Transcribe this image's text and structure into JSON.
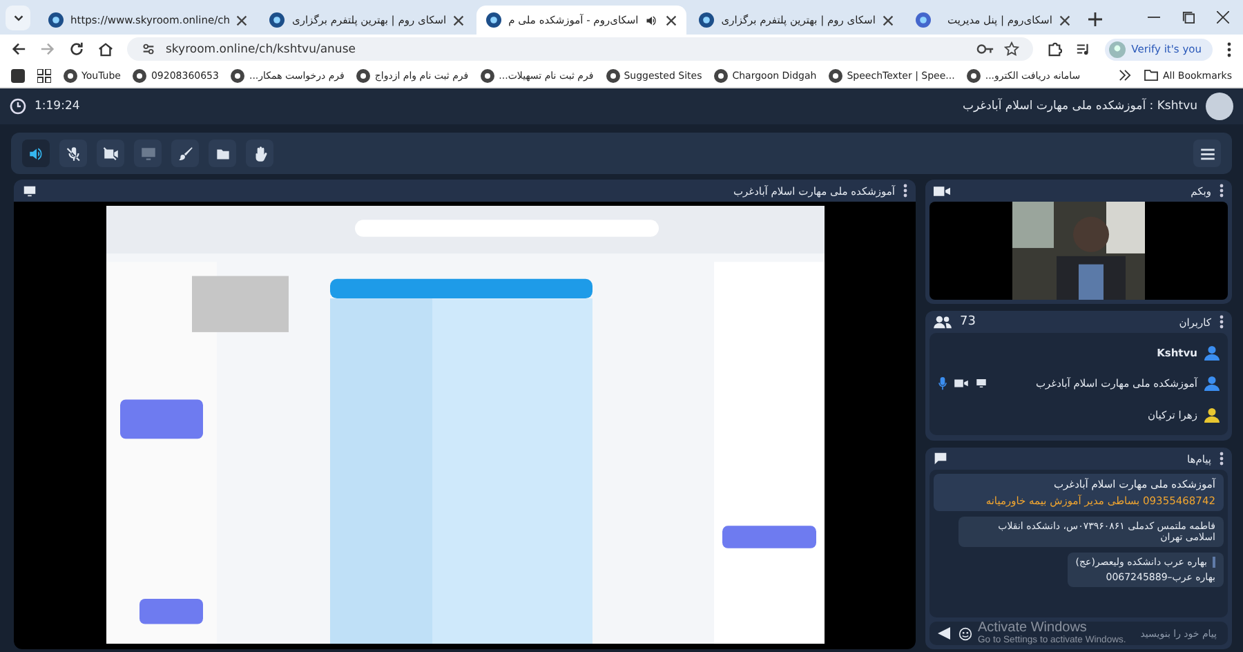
{
  "browser": {
    "tabs": [
      {
        "title": "اسکای‌روم | پنل مدیریت",
        "selected": false,
        "audio": false
      },
      {
        "title": "اسکای روم | بهترین پلتفرم برگزاری",
        "selected": false,
        "audio": false
      },
      {
        "title": "اسکای‌روم - آموزشکده ملی م",
        "selected": true,
        "audio": true
      },
      {
        "title": "اسکای روم | بهترین پلتفرم برگزاری",
        "selected": false,
        "audio": false
      },
      {
        "title": "https://www.skyroom.online/ch",
        "selected": false,
        "audio": false
      }
    ],
    "address": "skyroom.online/ch/kshtvu/anuse",
    "profile_button": "Verify it's you",
    "bookmarks": [
      {
        "label": "سامانه دریافت الکترو..."
      },
      {
        "label": "SpeechTexter | Spee..."
      },
      {
        "label": "Chargoon Didgah"
      },
      {
        "label": "Suggested Sites"
      },
      {
        "label": "فرم ثبت نام تسهیلات..."
      },
      {
        "label": "فرم ثبت نام وام ازدواج"
      },
      {
        "label": "فرم درخواست همکار..."
      },
      {
        "label": "09208360653"
      },
      {
        "label": "YouTube"
      }
    ],
    "all_bookmarks": "All Bookmarks"
  },
  "header": {
    "elapsed": "1:19:24",
    "room": "Kshtvu : آموزشکده ملی مهارت اسلام آبادغرب"
  },
  "toolbar": {
    "tools": [
      {
        "kind": "speaker",
        "selected": true,
        "disabled": false
      },
      {
        "kind": "mic-off",
        "selected": false,
        "disabled": false
      },
      {
        "kind": "camera-off",
        "selected": false,
        "disabled": false
      },
      {
        "kind": "screen",
        "selected": false,
        "disabled": true
      },
      {
        "kind": "brush",
        "selected": false,
        "disabled": false
      },
      {
        "kind": "folder",
        "selected": false,
        "disabled": false
      },
      {
        "kind": "hand",
        "selected": false,
        "disabled": false
      }
    ]
  },
  "share_panel": {
    "title": "آموزشکده ملی مهارت اسلام آبادغرب"
  },
  "webcam_panel": {
    "title": "وبکم"
  },
  "users_panel": {
    "title": "کاربران",
    "count": "73",
    "users": [
      {
        "name": "Kshtvu",
        "self": true,
        "color": "#3b8ef0",
        "controls": false
      },
      {
        "name": "آموزشکده ملی مهارت اسلام آبادغرب",
        "self": false,
        "color": "#3b8ef0",
        "controls": true
      },
      {
        "name": "زهرا ترکیان",
        "self": false,
        "color": "#e8c630",
        "controls": false
      }
    ]
  },
  "messages_panel": {
    "title": "پیام‌ها",
    "pinned": {
      "sender": "آموزشکده ملی مهارت اسلام آبادغرب",
      "text": "09355468742 بساطی مدیر آموزش بیمه خاورمیانه"
    },
    "messages": [
      {
        "text": "فاطمه ملتمس کدملی ۰۷۳۹۶۰۸۶۱س، دانشکده انقلاب اسلامی تهران"
      },
      {
        "quote": "بهاره عرب دانشکده ولیعصر(عج)",
        "text": "بهاره عرب–0067245889"
      }
    ],
    "input": {
      "placeholder": "پیام خود را بنویسید"
    }
  },
  "os_notice": {
    "title": "Activate Windows",
    "text": "Go to Settings to activate Windows."
  }
}
